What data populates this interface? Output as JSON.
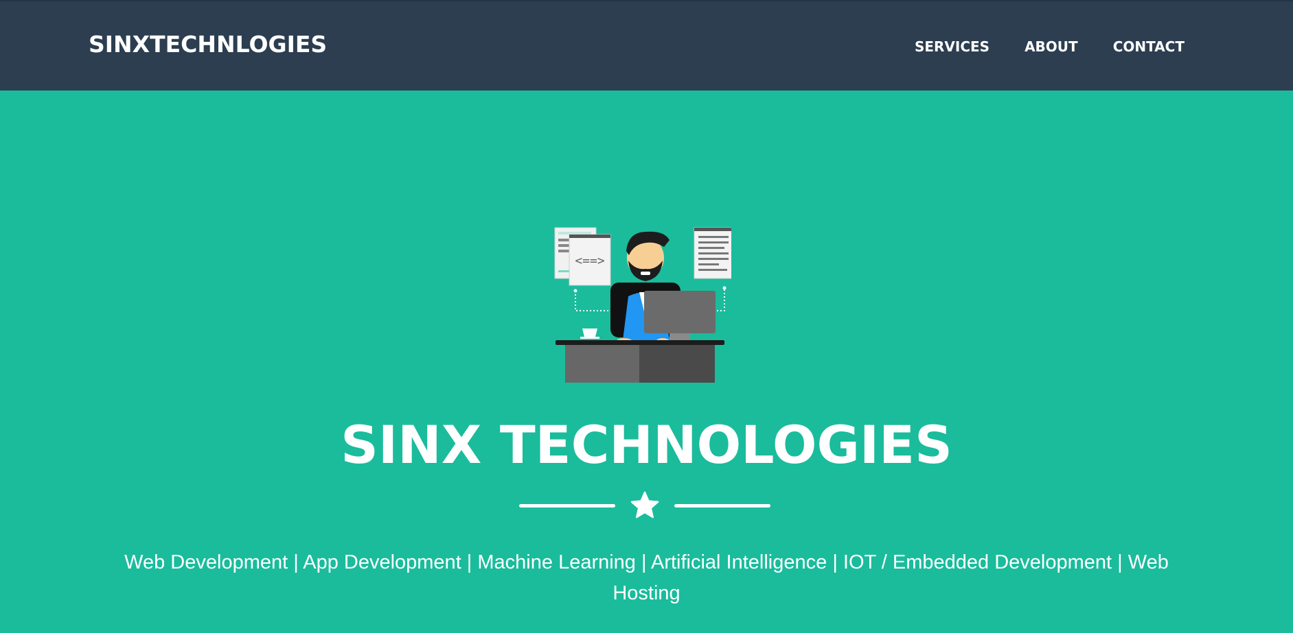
{
  "nav": {
    "brand": "SINXTECHNLOGIES",
    "links": [
      "SERVICES",
      "ABOUT",
      "CONTACT"
    ]
  },
  "hero": {
    "illustration": "developer-at-desk-illustration",
    "title": "SINX TECHNOLOGIES",
    "divider_icon": "star-icon",
    "subtitle": "Web Development | App Development | Machine Learning | Artificial Intelligence | IOT / Embedded Development | Web Hosting"
  },
  "colors": {
    "navbar": "#2c3e50",
    "hero_background": "#1abc9c",
    "text": "#ffffff"
  }
}
